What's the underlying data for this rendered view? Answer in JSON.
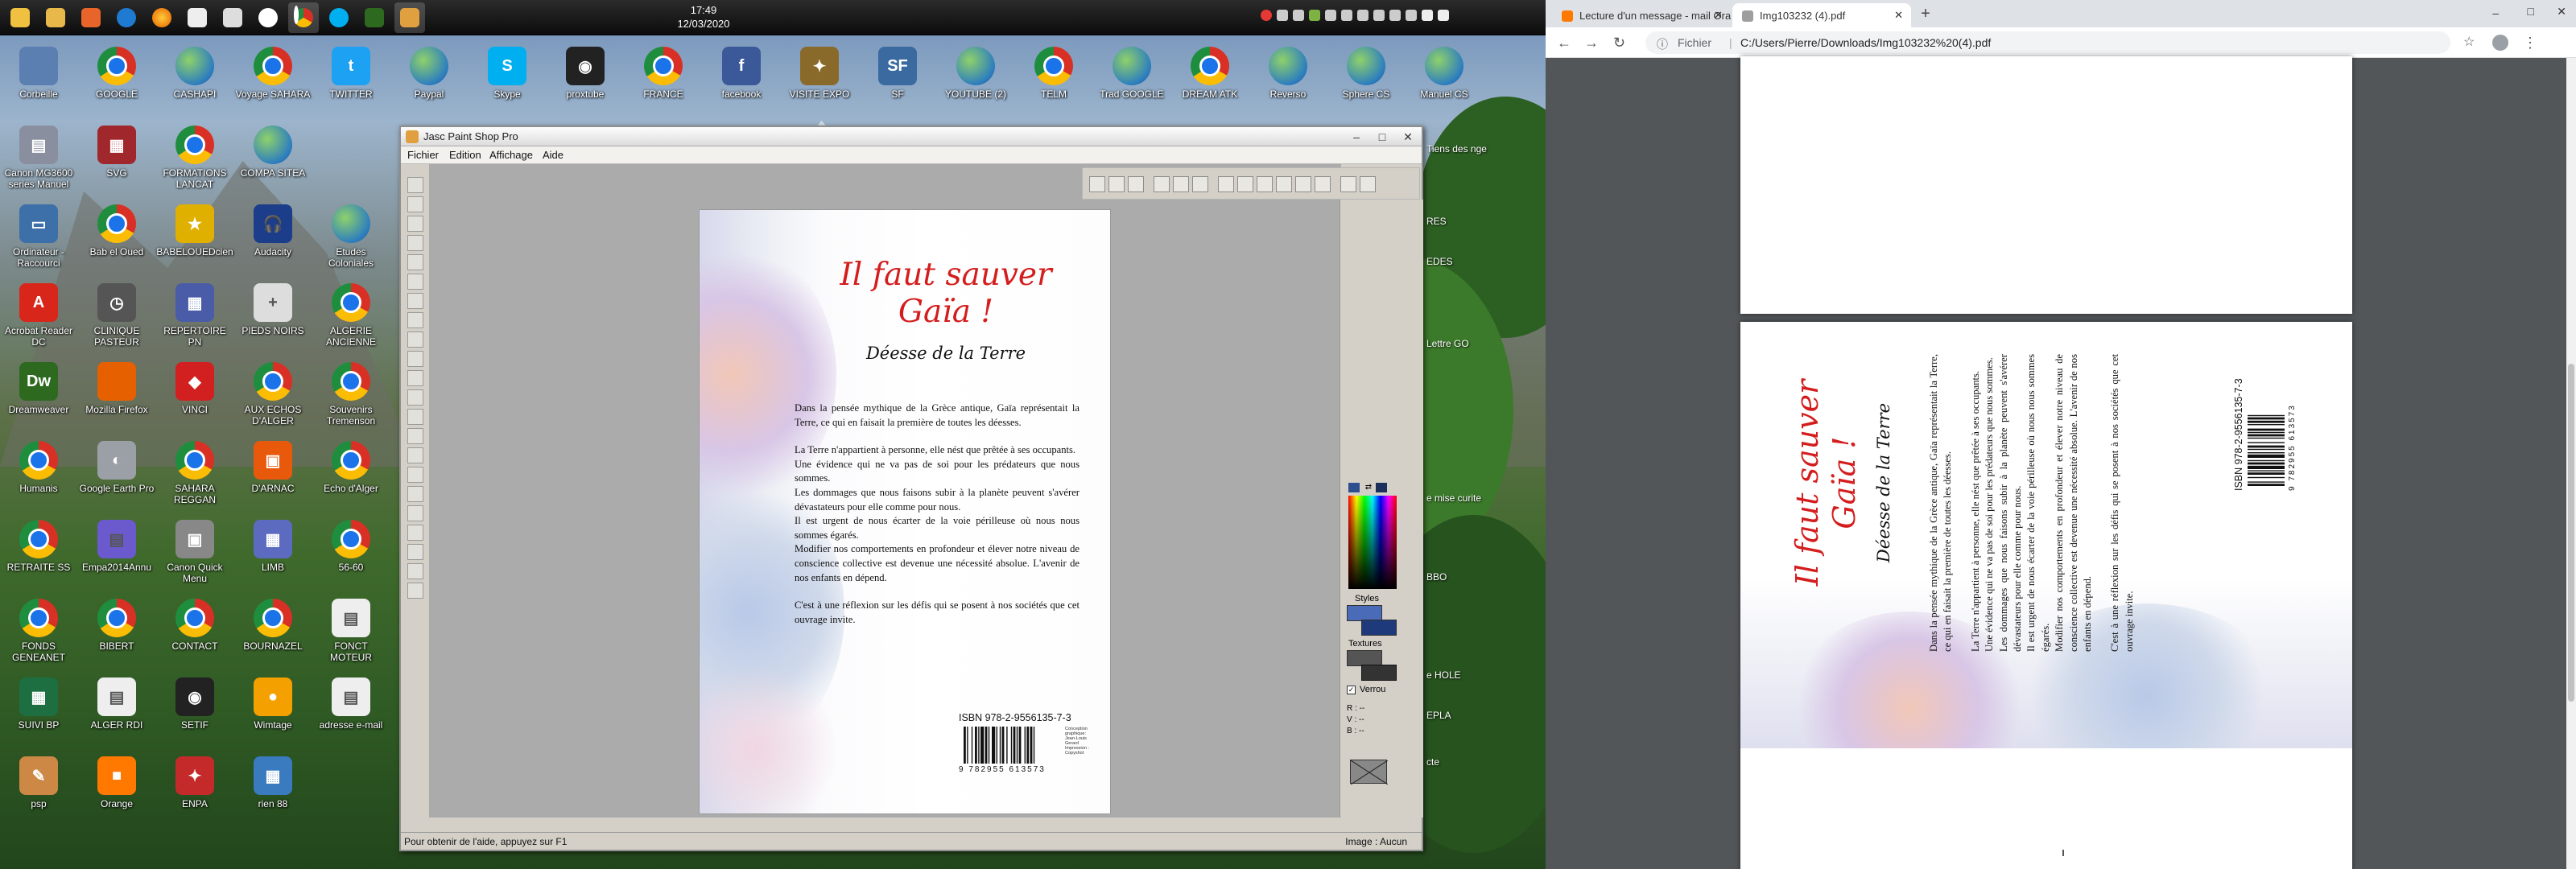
{
  "taskbar": {
    "clock_time": "17:49",
    "clock_date": "12/03/2020"
  },
  "desktop_icons": [
    {
      "label": "Corbeille",
      "icon": "recycle-bin-icon",
      "color": "#5b7fb0",
      "glyph": ""
    },
    {
      "label": "GOOGLE",
      "icon": "chrome-icon",
      "color": "#1a73e8",
      "glyph": ""
    },
    {
      "label": "CASHAPI",
      "icon": "globe-icon",
      "color": "#2d7ebf",
      "glyph": ""
    },
    {
      "label": "Voyage SAHARA",
      "icon": "chrome-icon",
      "color": "#1a73e8",
      "glyph": ""
    },
    {
      "label": "TWITTER",
      "icon": "twitter-icon",
      "color": "#1da1f2",
      "glyph": "t"
    },
    {
      "label": "Paypal",
      "icon": "globe-icon",
      "color": "#2d7ebf",
      "glyph": ""
    },
    {
      "label": "Skype",
      "icon": "skype-icon",
      "color": "#00aff0",
      "glyph": "S"
    },
    {
      "label": "proxtube",
      "icon": "proxtube-icon",
      "color": "#222222",
      "glyph": "◉"
    },
    {
      "label": "FRANCE",
      "icon": "chrome-icon",
      "color": "#1a73e8",
      "glyph": ""
    },
    {
      "label": "facebook",
      "icon": "facebook-icon",
      "color": "#3b5998",
      "glyph": "f"
    },
    {
      "label": "VISITE EXPO",
      "icon": "expo-icon",
      "color": "#8a6a2a",
      "glyph": "✦"
    },
    {
      "label": "SF",
      "icon": "sf-icon",
      "color": "#3a6aa0",
      "glyph": "SF"
    },
    {
      "label": "YOUTUBE (2)",
      "icon": "globe-icon",
      "color": "#2d7ebf",
      "glyph": ""
    },
    {
      "label": "TELM",
      "icon": "chrome-icon",
      "color": "#1a73e8",
      "glyph": ""
    },
    {
      "label": "Trad GOOGLE",
      "icon": "globe-icon",
      "color": "#2d7ebf",
      "glyph": ""
    },
    {
      "label": "DREAM ATK",
      "icon": "chrome-icon",
      "color": "#1a73e8",
      "glyph": ""
    },
    {
      "label": "Reverso",
      "icon": "globe-icon",
      "color": "#2d7ebf",
      "glyph": ""
    },
    {
      "label": "Sphere CS",
      "icon": "globe-icon",
      "color": "#2d7ebf",
      "glyph": ""
    },
    {
      "label": "Manuel CS",
      "icon": "globe-icon",
      "color": "#2d7ebf",
      "glyph": ""
    },
    {
      "label": "Canon MG3600 series Manuel",
      "icon": "canon-icon",
      "color": "#8a8fa0",
      "glyph": "▤"
    },
    {
      "label": "SVG",
      "icon": "svg-icon",
      "color": "#a0282c",
      "glyph": "▦"
    },
    {
      "label": "FORMATIONS LANCAT",
      "icon": "chrome-icon",
      "color": "#1a73e8",
      "glyph": ""
    },
    {
      "label": "COMPA SITEA",
      "icon": "globe-icon",
      "color": "#2d7ebf",
      "glyph": ""
    },
    {
      "label": "Ordinateur - Raccourci",
      "icon": "computer-icon",
      "color": "#3d6fa8",
      "glyph": "▭"
    },
    {
      "label": "Bab el Oued",
      "icon": "chrome-icon",
      "color": "#1a73e8",
      "glyph": ""
    },
    {
      "label": "BABELOUEDcien",
      "icon": "star-icon",
      "color": "#e0b000",
      "glyph": "★"
    },
    {
      "label": "Audacity",
      "icon": "audacity-icon",
      "color": "#1b3d8a",
      "glyph": "🎧"
    },
    {
      "label": "Etudes Coloniales",
      "icon": "globe-icon",
      "color": "#2d7ebf",
      "glyph": ""
    },
    {
      "label": "Acrobat Reader DC",
      "icon": "acrobat-icon",
      "color": "#d8261b",
      "glyph": "A"
    },
    {
      "label": "CLINIQUE PASTEUR",
      "icon": "clock-icon",
      "color": "#555555",
      "glyph": "◷"
    },
    {
      "label": "REPERTOIRE PN",
      "icon": "repertoire-icon",
      "color": "#4a5ca8",
      "glyph": "▦"
    },
    {
      "label": "PIEDS NOIRS",
      "icon": "addressbook-icon",
      "color": "#dddddd",
      "glyph": "+"
    },
    {
      "label": "ALGERIE ANCIENNE",
      "icon": "chrome-icon",
      "color": "#1a73e8",
      "glyph": ""
    },
    {
      "label": "Dreamweaver",
      "icon": "dreamweaver-icon",
      "color": "#2d6a1f",
      "glyph": "Dw"
    },
    {
      "label": "Mozilla Firefox",
      "icon": "firefox-icon",
      "color": "#e66000",
      "glyph": ""
    },
    {
      "label": "VINCI",
      "icon": "vinci-icon",
      "color": "#d22020",
      "glyph": "◆"
    },
    {
      "label": "AUX ECHOS D'ALGER",
      "icon": "chrome-icon",
      "color": "#1a73e8",
      "glyph": ""
    },
    {
      "label": "Souvenirs Tremenson",
      "icon": "chrome-icon",
      "color": "#1a73e8",
      "glyph": ""
    },
    {
      "label": "Humanis",
      "icon": "chrome-icon",
      "color": "#1a73e8",
      "glyph": ""
    },
    {
      "label": "Google Earth Pro",
      "icon": "earth-icon",
      "color": "#9aa0a6",
      "glyph": "◐"
    },
    {
      "label": "SAHARA REGGAN",
      "icon": "chrome-icon",
      "color": "#1a73e8",
      "glyph": ""
    },
    {
      "label": "D'ARNAC",
      "icon": "office-icon",
      "color": "#e8590c",
      "glyph": "▣"
    },
    {
      "label": "Echo d'Alger",
      "icon": "chrome-icon",
      "color": "#1a73e8",
      "glyph": ""
    },
    {
      "label": "RETRAITE SS",
      "icon": "chrome-icon",
      "color": "#1a73e8",
      "glyph": ""
    },
    {
      "label": "Empa2014Annu",
      "icon": "document-icon",
      "color": "#6a5acd",
      "glyph": "▤"
    },
    {
      "label": "Canon Quick Menu",
      "icon": "canon-quick-icon",
      "color": "#888888",
      "glyph": "▣"
    },
    {
      "label": "LIMB",
      "icon": "limb-icon",
      "color": "#5c6bc0",
      "glyph": "▦"
    },
    {
      "label": "56-60",
      "icon": "chrome-icon",
      "color": "#1a73e8",
      "glyph": ""
    },
    {
      "label": "FONDS GENEANET",
      "icon": "chrome-icon",
      "color": "#1a73e8",
      "glyph": ""
    },
    {
      "label": "BIBERT",
      "icon": "chrome-icon",
      "color": "#1a73e8",
      "glyph": ""
    },
    {
      "label": "CONTACT",
      "icon": "chrome-icon",
      "color": "#1a73e8",
      "glyph": ""
    },
    {
      "label": "BOURNAZEL",
      "icon": "chrome-icon",
      "color": "#1a73e8",
      "glyph": ""
    },
    {
      "label": "FONCT MOTEUR",
      "icon": "document-icon",
      "color": "#eeeeee",
      "glyph": "▤"
    },
    {
      "label": "SUIVI BP",
      "icon": "spreadsheet-icon",
      "color": "#1d6f42",
      "glyph": "▦"
    },
    {
      "label": "ALGER RDI",
      "icon": "document-icon",
      "color": "#eeeeee",
      "glyph": "▤"
    },
    {
      "label": "SETIF",
      "icon": "proxtube-icon",
      "color": "#222222",
      "glyph": "◉"
    },
    {
      "label": "Wimtage",
      "icon": "wimtage-icon",
      "color": "#f4a000",
      "glyph": "●"
    },
    {
      "label": "adresse e-mail",
      "icon": "text-icon",
      "color": "#eeeeee",
      "glyph": "▤"
    },
    {
      "label": "psp",
      "icon": "psp-icon",
      "color": "#c84",
      "glyph": "✎"
    },
    {
      "label": "Orange",
      "icon": "orange-icon",
      "color": "#ff7900",
      "glyph": "■"
    },
    {
      "label": "ENPA",
      "icon": "enpa-icon",
      "color": "#c42a2a",
      "glyph": "✦"
    },
    {
      "label": "rien 88",
      "icon": "image-icon",
      "color": "#3a7abf",
      "glyph": "▦"
    }
  ],
  "right_edge_labels": [
    "Lettre GO",
    "e mise curite",
    "BBO",
    "RES",
    "e HOLE",
    "cte",
    "EPLA",
    "Tiens des nge",
    "EDES"
  ],
  "psp": {
    "title": "Jasc Paint Shop Pro",
    "menu": [
      "Fichier",
      "Edition",
      "Affichage",
      "Aide"
    ],
    "status_left": "Pour obtenir de l'aide, appuyez sur F1",
    "status_right": "Image : Aucun",
    "palette": {
      "styles": "Styles",
      "textures": "Textures",
      "lock": "Verrou",
      "r": "R :",
      "v": "V :",
      "b": "B :",
      "dash": "--"
    }
  },
  "cover": {
    "title_line1": "Il faut sauver",
    "title_line2": "Gaïa !",
    "subtitle": "Déesse de la Terre",
    "paragraphs": [
      "Dans la pensée mythique de la Grèce antique, Gaïa représentait la Terre, ce qui en faisait la première de toutes les déesses.",
      "La Terre n'appartient à personne, elle nést que prêtée à ses occupants.",
      "Une évidence qui ne va pas de soi pour les prédateurs que nous sommes.",
      "Les dommages que nous faisons subir à la planète peuvent s'avérer dévastateurs pour elle comme pour nous.",
      "Il est urgent de nous écarter de la voie périlleuse où nous nous sommes égarés.",
      "Modifier nos comportements en profondeur et élever notre niveau de conscience collective est devenue une nécessité absolue. L'avenir de nos enfants en dépend.",
      "C'est à une réflexion sur les défis qui se posent à nos sociétés que cet ouvrage invite."
    ],
    "isbn": "ISBN 978-2-9556135-7-3",
    "barcode_digits": "9 782955 613573",
    "small_print": "Conception graphique: Jean-Louis Gerard Impression : Copyshot"
  },
  "chrome": {
    "tabs": [
      {
        "label": "Lecture d'un message - mail Ora",
        "favicon_color": "#ff7900",
        "active": false
      },
      {
        "label": "Img103232 (4).pdf",
        "favicon_color": "#9e9e9e",
        "active": true
      }
    ],
    "new_tab": "+",
    "site_label": "Fichier",
    "url": "C:/Users/Pierre/Downloads/Img103232%20(4).pdf",
    "info_icon": "ⓘ"
  },
  "pdf_page": {
    "title_line1": "Il faut sauver",
    "title_line2": "Gaïa !",
    "subtitle": "Déesse de la Terre",
    "paragraphs": [
      "Dans la pensée mythique de la Grèce antique, Gaïa représentait la Terre, ce qui en faisait la première de toutes les déesses.",
      "La Terre n'appartient à personne, elle nést que prêtée à ses occupants.",
      "Une évidence qui ne va pas de soi pour les prédateurs que nous sommes.",
      "Les dommages que nous faisons subir à la planète peuvent s'avérer dévastateurs pour elle comme pour nous.",
      "Il est urgent de nous écarter de la voie périlleuse où nous nous sommes égarés.",
      "Modifier nos comportements en profondeur et élever notre niveau de conscience collective est devenue une nécessité absolue. L'avenir de nos enfants en dépend.",
      "C'est à une réflexion sur les défis qui se posent à nos sociétés que cet ouvrage invite."
    ],
    "isbn": "ISBN 978-2-9556135-7-3",
    "barcode_digits": "9 782955 613573"
  },
  "colors": {
    "title_red": "#d41e1e",
    "chrome_tabbar": "#dee1e6",
    "pdf_bg": "#525659",
    "psp_gray": "#d4d0c8"
  }
}
